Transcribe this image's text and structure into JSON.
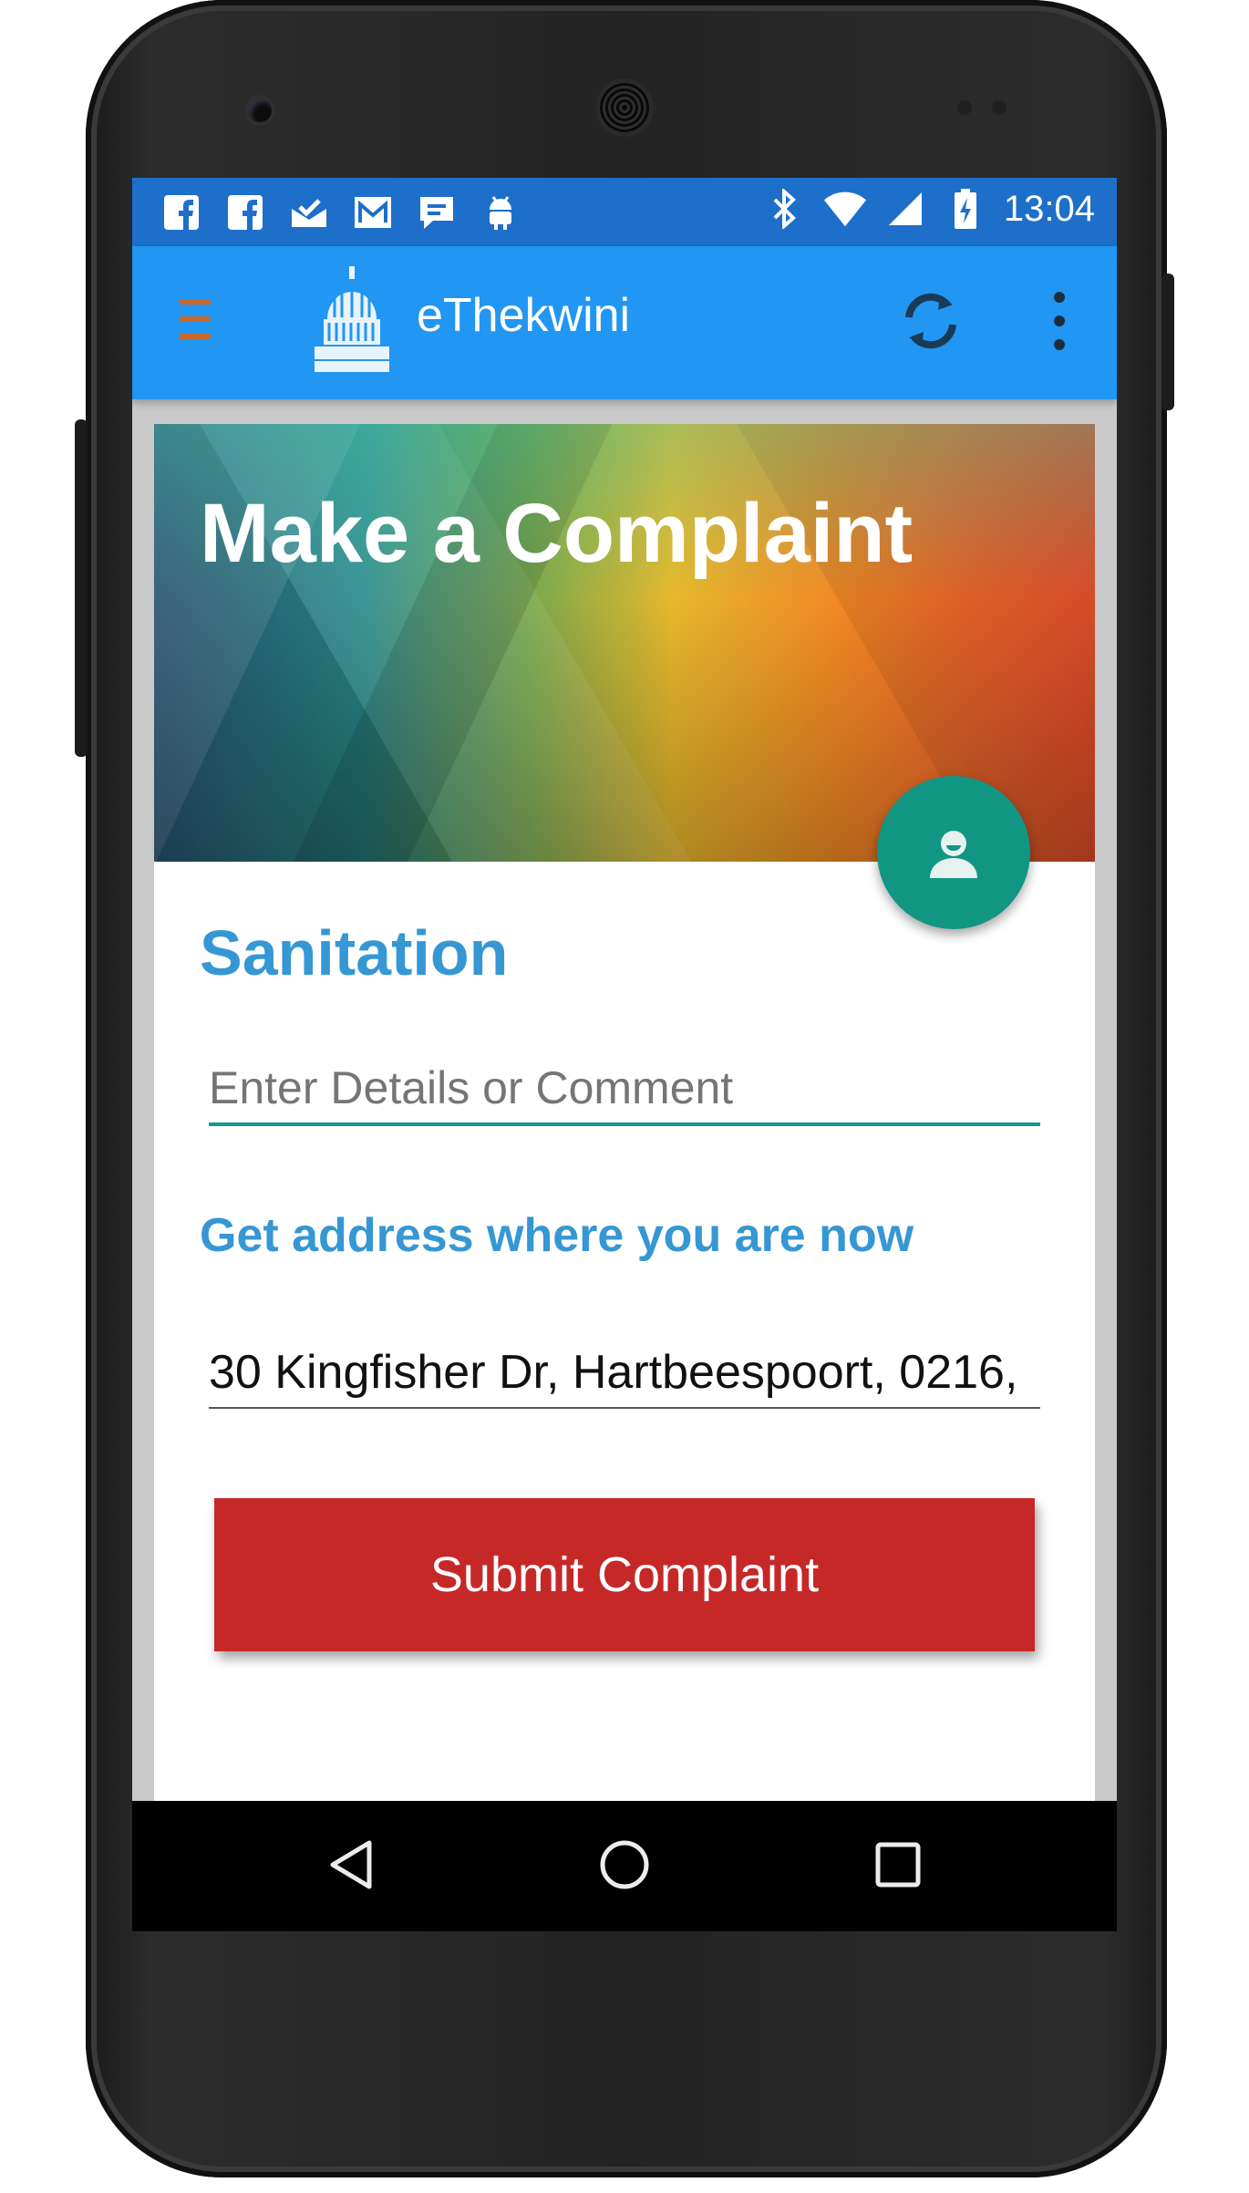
{
  "status_bar": {
    "time": "13:04",
    "left_icons": [
      "facebook-icon",
      "facebook-icon",
      "inbox-icon",
      "gmail-icon",
      "chat-icon",
      "android-icon"
    ],
    "right_icons": [
      "bluetooth-icon",
      "wifi-icon",
      "cell-signal-icon",
      "battery-charging-icon"
    ]
  },
  "app_bar": {
    "title": "eThekwini",
    "menu_icon": "hamburger-icon",
    "logo": "ethekwini-municipality-logo",
    "actions": [
      "refresh-icon",
      "overflow-menu-icon"
    ]
  },
  "hero": {
    "title": "Make a Complaint"
  },
  "form": {
    "category": "Sanitation",
    "details_placeholder": "Enter Details or Comment",
    "details_value": "",
    "get_address_label": "Get address where you are now",
    "address_value": "30 Kingfisher Dr, Hartbeespoort, 0216,",
    "submit_label": "Submit Complaint"
  },
  "fab": {
    "icon": "person-icon"
  },
  "navigation_bar": {
    "buttons": [
      "back-icon",
      "home-icon",
      "recents-icon"
    ]
  },
  "colors": {
    "status_bar": "#1e6fc9",
    "app_bar": "#2196f3",
    "accent": "#3597d3",
    "fab": "#119684",
    "input_underline": "#0f9a8a",
    "submit_button": "#c62828"
  }
}
